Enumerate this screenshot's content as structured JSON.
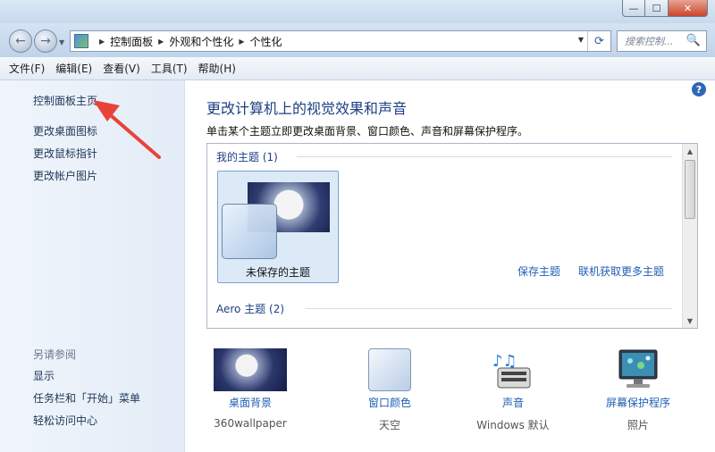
{
  "window": {
    "caption": {
      "minimize": "—",
      "maximize": "☐",
      "close": "✕"
    }
  },
  "nav": {
    "back_icon": "←",
    "forward_icon": "→",
    "breadcrumb": [
      "控制面板",
      "外观和个性化",
      "个性化"
    ],
    "search_placeholder": "搜索控制...",
    "refresh_icon": "⟳",
    "search_icon": "🔍"
  },
  "menu": [
    "文件(F)",
    "编辑(E)",
    "查看(V)",
    "工具(T)",
    "帮助(H)"
  ],
  "sidebar": {
    "home": "控制面板主页",
    "links": [
      "更改桌面图标",
      "更改鼠标指针",
      "更改帐户图片"
    ],
    "see_also": "另请参阅",
    "see_also_links": [
      "显示",
      "任务栏和「开始」菜单",
      "轻松访问中心"
    ]
  },
  "main": {
    "help": "?",
    "title": "更改计算机上的视觉效果和声音",
    "description": "单击某个主题立即更改桌面背景、窗口颜色、声音和屏幕保护程序。",
    "my_themes_header": "我的主题 (1)",
    "unsaved_theme": "未保存的主题",
    "save_theme": "保存主题",
    "get_more_themes": "联机获取更多主题",
    "aero_header": "Aero 主题 (2)"
  },
  "bottom": [
    {
      "label": "桌面背景",
      "sub": "360wallpaper"
    },
    {
      "label": "窗口颜色",
      "sub": "天空"
    },
    {
      "label": "声音",
      "sub": "Windows 默认"
    },
    {
      "label": "屏幕保护程序",
      "sub": "照片"
    }
  ],
  "colors": {
    "accent": "#1e3f83",
    "link": "#1f5fb4",
    "arrow": "#e8433a"
  }
}
